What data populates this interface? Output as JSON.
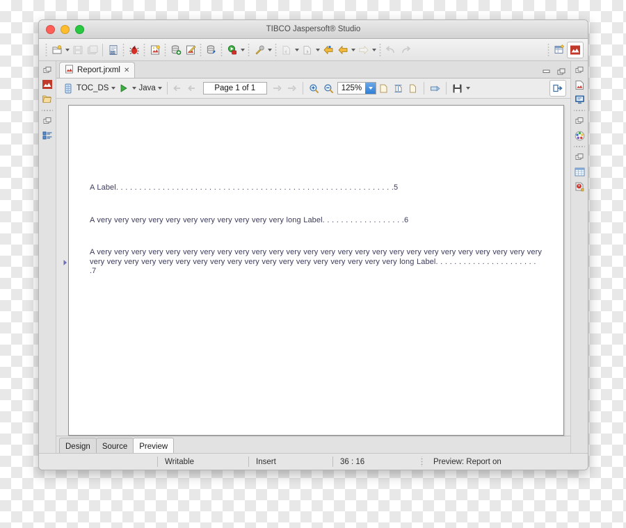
{
  "window": {
    "title": "TIBCO Jaspersoft® Studio",
    "controls": {
      "close": "close-button",
      "minimize": "minimize-button",
      "zoom": "zoom-button"
    }
  },
  "main_toolbar": {
    "buttons": [
      {
        "name": "new-report-button",
        "icon": "new-file-icon",
        "has_caret": true
      },
      {
        "name": "save-button",
        "icon": "save-disk-icon",
        "has_caret": false
      },
      {
        "name": "save-all-button",
        "icon": "save-all-icon",
        "has_caret": false
      },
      {
        "name": "compile-report-button",
        "icon": "compile-010-icon",
        "has_caret": false
      },
      {
        "name": "debug-button",
        "icon": "bug-icon",
        "has_caret": false
      },
      {
        "name": "preview-button",
        "icon": "image-report-icon",
        "has_caret": false
      },
      {
        "name": "datasource-button",
        "icon": "database-add-icon",
        "has_caret": false
      },
      {
        "name": "edit-expression-button",
        "icon": "pencil-report-icon",
        "has_caret": false
      },
      {
        "name": "data-adapter-button",
        "icon": "database-blue-icon",
        "has_caret": false
      },
      {
        "name": "run-button",
        "icon": "run-green-icon",
        "has_caret": true
      },
      {
        "name": "tools-button",
        "icon": "wrench-icon",
        "has_caret": true
      },
      {
        "name": "previous-annotation-button",
        "icon": "prev-annotation-icon",
        "has_caret": true
      },
      {
        "name": "next-annotation-button",
        "icon": "next-annotation-icon",
        "has_caret": true
      },
      {
        "name": "back-button",
        "icon": "back-arrow-icon",
        "has_caret": false
      },
      {
        "name": "forward-back-button",
        "icon": "back-arrow-2-icon",
        "has_caret": true
      },
      {
        "name": "forward-button",
        "icon": "forward-arrow-icon",
        "has_caret": true
      },
      {
        "name": "undo-button",
        "icon": "undo-icon",
        "has_caret": false
      },
      {
        "name": "redo-button",
        "icon": "redo-icon",
        "has_caret": false
      }
    ],
    "perspectives": [
      {
        "name": "open-perspective-button",
        "icon": "open-perspective-icon",
        "active": false
      },
      {
        "name": "perspective-report-design",
        "icon": "report-perspective-icon",
        "active": true
      }
    ]
  },
  "left_rail": [
    {
      "name": "rail-restore-icon",
      "icon": "restore-view-icon"
    },
    {
      "name": "rail-report-designer-icon",
      "icon": "report-red-icon"
    },
    {
      "name": "rail-repository-icon",
      "icon": "folder-icon"
    },
    {
      "name": "rail-dots",
      "icon": "dots-handle-icon"
    },
    {
      "name": "rail-restore-icon-2",
      "icon": "restore-view-icon"
    },
    {
      "name": "rail-outline-icon",
      "icon": "outline-icon"
    }
  ],
  "right_rail": [
    {
      "name": "rail-restore-icon-r1",
      "icon": "restore-view-icon"
    },
    {
      "name": "rail-report-thumbnail-icon",
      "icon": "report-thumb-icon"
    },
    {
      "name": "rail-console-icon",
      "icon": "console-blue-icon"
    },
    {
      "name": "rail-dots-r1",
      "icon": "dots-handle-icon"
    },
    {
      "name": "rail-restore-icon-r2",
      "icon": "restore-view-icon"
    },
    {
      "name": "rail-palette-icon",
      "icon": "color-palette-icon"
    },
    {
      "name": "rail-dots-r2",
      "icon": "dots-handle-icon"
    },
    {
      "name": "rail-restore-icon-r3",
      "icon": "restore-view-icon"
    },
    {
      "name": "rail-properties-icon",
      "icon": "table-properties-icon"
    },
    {
      "name": "rail-problems-icon",
      "icon": "problems-icon"
    }
  ],
  "editor": {
    "tab": {
      "label": "Report.jrxml",
      "icon": "jrxml-file-icon",
      "close": "✕"
    },
    "tab_min": "minimize-editor-icon",
    "tab_max": "maximize-editor-icon"
  },
  "preview_toolbar": {
    "datasource_icon": "datasource-icon",
    "datasource": "TOC_DS",
    "run_icon": "run-green-icon",
    "language": "Java",
    "nav_first": "first-page-icon",
    "nav_prev": "previous-page-icon",
    "page_label": "Page 1 of 1",
    "nav_next": "next-page-icon",
    "nav_last": "last-page-icon",
    "zoom_in": "zoom-in-icon",
    "zoom_out": "zoom-out-icon",
    "zoom_value": "125%",
    "fit_width_icon": "fit-width-icon",
    "actual_size_icon": "actual-size-icon",
    "fit_page_icon": "fit-page-icon",
    "whole_page_icon": "whole-page-icon",
    "export_icon": "export-icon",
    "save_icon": "save-disk-icon",
    "reload_icon": "reload-report-icon"
  },
  "report": {
    "entries": [
      {
        "label": "A Label",
        "dots": ". . . . . . . . . . . . . . . . . . . . . . . . . . . . . . . . . . . . . . . . . . . . . . . . . . . . . . . . . . . .",
        "page": "5"
      },
      {
        "label": "A very very very very very very very very very very very long Label",
        "dots": ". . . . . . . . . . . . . . . . . .",
        "page": "6"
      },
      {
        "label": "A very very very very very very very very very very very very very very very very very very very very very very very very very very very very very very very very very very very very very very very very very very very very long Label",
        "dots": ". . . . . . . . . . . . . . . . . . . . . . .",
        "page": "7"
      }
    ],
    "gutter_marker": "collapse-marker-icon"
  },
  "bottom_tabs": [
    {
      "label": "Design",
      "active": false
    },
    {
      "label": "Source",
      "active": false
    },
    {
      "label": "Preview",
      "active": true
    }
  ],
  "status_bar": {
    "writable": "Writable",
    "insert": "Insert",
    "position": "36 : 16",
    "task": "Preview: Report on"
  },
  "colors": {
    "accent_blue": "#2f7fd6",
    "toc_text": "#3b3b5c",
    "window_chrome": "#ebebeb",
    "title_text": "#4a4a4a",
    "perspective_red": "#c0392b"
  }
}
